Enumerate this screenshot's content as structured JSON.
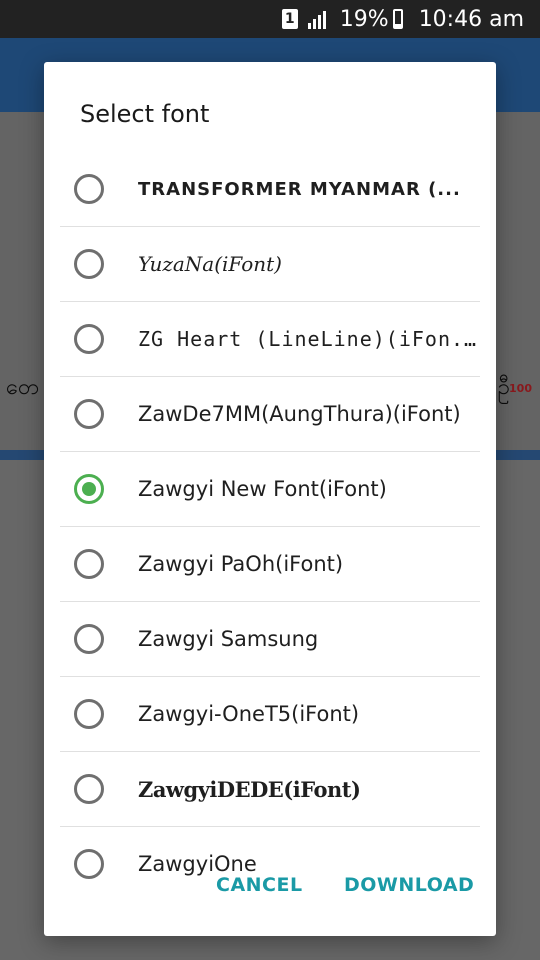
{
  "status_bar": {
    "sim": "1",
    "battery": "19%",
    "time": "10:46 am"
  },
  "background": {
    "left_text": "တေ",
    "right_text": "ဦ",
    "badge": "100"
  },
  "dialog": {
    "title": "Select font",
    "items": [
      {
        "label": "TRANSFORMER MYANMAR (...",
        "checked": false
      },
      {
        "label": "YuzaNa(iFont)",
        "checked": false
      },
      {
        "label": "ZG Heart (LineLine)(iFon...",
        "checked": false
      },
      {
        "label": "ZawDe7MM(AungThura)(iFont)",
        "checked": false
      },
      {
        "label": "Zawgyi New Font(iFont)",
        "checked": true
      },
      {
        "label": "Zawgyi PaOh(iFont)",
        "checked": false
      },
      {
        "label": "Zawgyi Samsung",
        "checked": false
      },
      {
        "label": "Zawgyi-OneT5(iFont)",
        "checked": false
      },
      {
        "label": "ZawgyiDEDE(iFont)",
        "checked": false
      },
      {
        "label": "ZawgyiOne",
        "checked": false
      }
    ],
    "actions": {
      "cancel_label": "CANCEL",
      "download_label": "DOWNLOAD"
    }
  },
  "colors": {
    "accent": "#1a9aa6",
    "radio_selected": "#4caf50",
    "toolbar": "#2f6fb5"
  }
}
